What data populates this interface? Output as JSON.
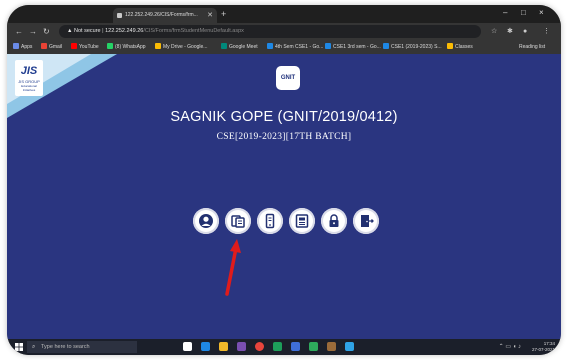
{
  "browser": {
    "tab_title": "122.252.249.26/CIS/Forms/frm...",
    "new_tab_symbol": "+",
    "window_controls": [
      "–",
      "□",
      "×"
    ],
    "security_label": "Not secure",
    "url_host": "122.252.249.26",
    "url_path": "/CIS/Forms/frmStudentMenuDefault.aspx",
    "bookmarks": [
      {
        "label": "Apps",
        "color": "#6a8be8"
      },
      {
        "label": "Gmail",
        "color": "#ea4335"
      },
      {
        "label": "YouTube",
        "color": "#ff0000"
      },
      {
        "label": "(8) WhatsApp",
        "color": "#25d366"
      },
      {
        "label": "My Drive - Google...",
        "color": "#fbbc04"
      },
      {
        "label": "Google Meet",
        "color": "#00897b"
      },
      {
        "label": "4th Sem CSE1 - Go...",
        "color": "#1e88e5"
      },
      {
        "label": "CSE1 3rd sem - Go...",
        "color": "#1e88e5"
      },
      {
        "label": "CSE1 (2019-2023) S...",
        "color": "#1e88e5"
      },
      {
        "label": "Classes",
        "color": "#fbbc04"
      }
    ],
    "reading_list_label": "Reading list"
  },
  "page": {
    "logo_mark": "JIS",
    "logo_name": "JIS GROUP",
    "logo_tagline": "Educational Initiatives",
    "college_badge": "GNIT",
    "student_name": "SAGNIK GOPE (GNIT/2019/0412)",
    "batch": "CSE[2019-2023][17TH BATCH]",
    "menu_icons": [
      "profile-icon",
      "documents-icon",
      "mobile-device-icon",
      "id-card-icon",
      "lock-icon",
      "exit-door-icon"
    ],
    "arrow_color": "#e01b1b"
  },
  "taskbar": {
    "search_placeholder": "Type here to search",
    "time": "17:34",
    "date": "27-07-2021"
  }
}
